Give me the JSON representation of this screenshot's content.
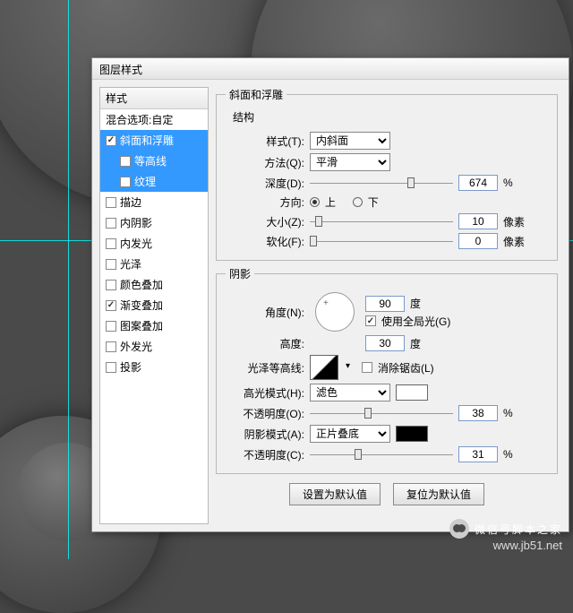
{
  "dialog_title": "图层样式",
  "sidebar": {
    "header": "样式",
    "blend": "混合选项:自定",
    "items": [
      {
        "label": "斜面和浮雕",
        "checked": true,
        "selected": true
      },
      {
        "label": "等高线",
        "checked": false,
        "indent": true,
        "selected": true
      },
      {
        "label": "纹理",
        "checked": false,
        "indent": true,
        "selected": true
      },
      {
        "label": "描边",
        "checked": false
      },
      {
        "label": "内阴影",
        "checked": false
      },
      {
        "label": "内发光",
        "checked": false
      },
      {
        "label": "光泽",
        "checked": false
      },
      {
        "label": "颜色叠加",
        "checked": false
      },
      {
        "label": "渐变叠加",
        "checked": true
      },
      {
        "label": "图案叠加",
        "checked": false
      },
      {
        "label": "外发光",
        "checked": false
      },
      {
        "label": "投影",
        "checked": false
      }
    ]
  },
  "panel": {
    "title": "斜面和浮雕",
    "structure": {
      "legend": "结构",
      "style_label": "样式(T):",
      "style_value": "内斜面",
      "method_label": "方法(Q):",
      "method_value": "平滑",
      "depth_label": "深度(D):",
      "depth_value": "674",
      "depth_unit": "%",
      "direction_label": "方向:",
      "up": "上",
      "down": "下",
      "size_label": "大小(Z):",
      "size_value": "10",
      "size_unit": "像素",
      "soften_label": "软化(F):",
      "soften_value": "0",
      "soften_unit": "像素"
    },
    "shading": {
      "legend": "阴影",
      "angle_label": "角度(N):",
      "angle_value": "90",
      "angle_unit": "度",
      "global_label": "使用全局光(G)",
      "altitude_label": "高度:",
      "altitude_value": "30",
      "altitude_unit": "度",
      "contour_label": "光泽等高线:",
      "antialias_label": "消除锯齿(L)",
      "highlight_mode_label": "高光模式(H):",
      "highlight_mode_value": "滤色",
      "highlight_color": "#ffffff",
      "highlight_opacity_label": "不透明度(O):",
      "highlight_opacity_value": "38",
      "pct": "%",
      "shadow_mode_label": "阴影模式(A):",
      "shadow_mode_value": "正片叠底",
      "shadow_color": "#000000",
      "shadow_opacity_label": "不透明度(C):",
      "shadow_opacity_value": "31"
    },
    "buttons": {
      "default": "设置为默认值",
      "reset": "复位为默认值"
    }
  },
  "watermark": {
    "line1": "微信号脚本之家",
    "line2": "www.jb51.net"
  }
}
